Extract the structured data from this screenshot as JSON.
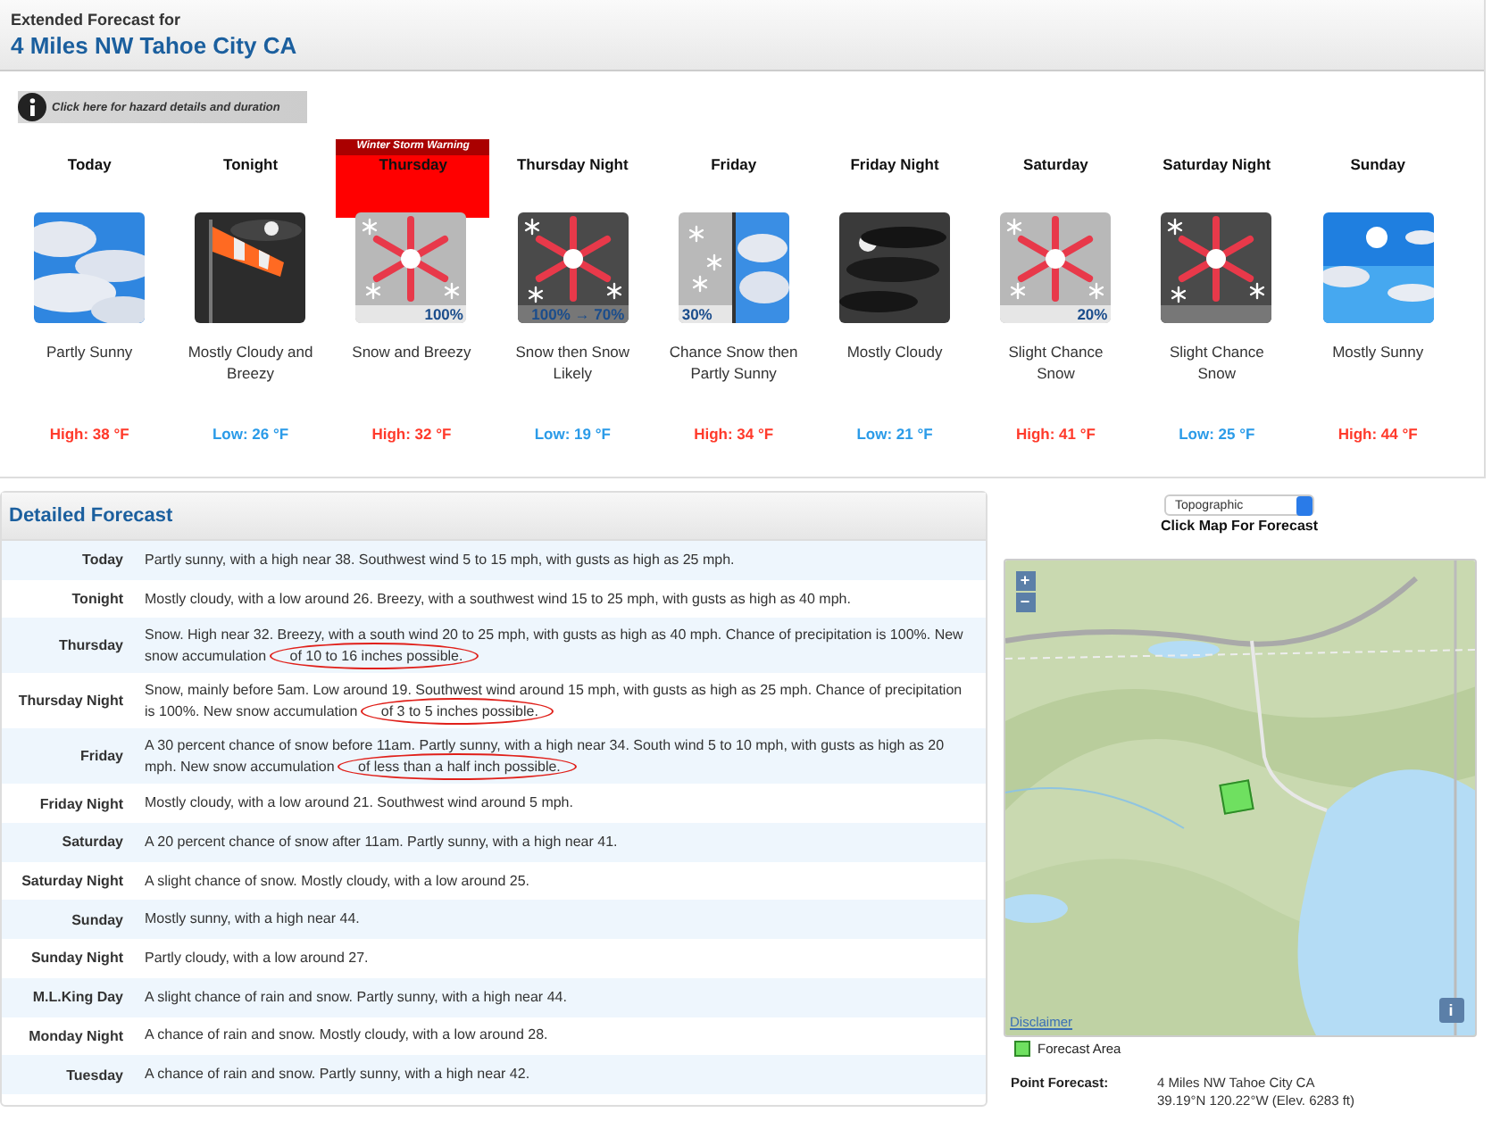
{
  "header": {
    "subtitle": "Extended Forecast for",
    "location": "4 Miles NW Tahoe City CA"
  },
  "hazard_button": {
    "label": "Click here for hazard details and duration"
  },
  "periods": [
    {
      "name": "Today",
      "kind": "partly-sunny",
      "short": "Partly Sunny",
      "temp": {
        "kind": "high",
        "text": "High: 38 °F"
      }
    },
    {
      "name": "Tonight",
      "kind": "windsock-night",
      "short": "Mostly Cloudy and Breezy",
      "temp": {
        "kind": "low",
        "text": "Low: 26 °F"
      }
    },
    {
      "name": "Thursday",
      "kind": "snow",
      "pop": "100%",
      "short": "Snow and Breezy",
      "temp": {
        "kind": "high",
        "text": "High: 32 °F"
      },
      "warning": "Winter Storm Warning"
    },
    {
      "name": "Thursday Night",
      "kind": "snow-night",
      "pop": "100% → 70%",
      "short": "Snow then Snow Likely",
      "temp": {
        "kind": "low",
        "text": "Low: 19 °F"
      }
    },
    {
      "name": "Friday",
      "kind": "chance-snow-sunny",
      "pop": "30%",
      "short": "Chance Snow then Partly Sunny",
      "temp": {
        "kind": "high",
        "text": "High: 34 °F"
      }
    },
    {
      "name": "Friday Night",
      "kind": "cloudy-night",
      "short": "Mostly Cloudy",
      "temp": {
        "kind": "low",
        "text": "Low: 21 °F"
      }
    },
    {
      "name": "Saturday",
      "kind": "snow",
      "pop": "20%",
      "short": "Slight Chance Snow",
      "temp": {
        "kind": "high",
        "text": "High: 41 °F"
      }
    },
    {
      "name": "Saturday Night",
      "kind": "snow-night",
      "short": "Slight Chance Snow",
      "temp": {
        "kind": "low",
        "text": "Low: 25 °F"
      }
    },
    {
      "name": "Sunday",
      "kind": "sunny",
      "short": "Mostly Sunny",
      "temp": {
        "kind": "high",
        "text": "High: 44 °F"
      }
    }
  ],
  "detailed": {
    "title": "Detailed Forecast",
    "rows": [
      {
        "period": "Today",
        "text": "Partly sunny, with a high near 38. Southwest wind 5 to 15 mph, with gusts as high as 25 mph."
      },
      {
        "period": "Tonight",
        "text": "Mostly cloudy, with a low around 26. Breezy, with a southwest wind 15 to 25 mph, with gusts as high as 40 mph."
      },
      {
        "period": "Thursday",
        "text": "Snow. High near 32. Breezy, with a south wind 20 to 25 mph, with gusts as high as 40 mph. Chance of precipitation is 100%. New snow accumulation",
        "circled": " of 10 to 16 inches possible."
      },
      {
        "period": "Thursday Night",
        "text": "Snow, mainly before 5am. Low around 19. Southwest wind around 15 mph, with gusts as high as 25 mph. Chance of precipitation is 100%. New snow accumulation",
        "circled": " of 3 to 5 inches possible."
      },
      {
        "period": "Friday",
        "text": "A 30 percent chance of snow before 11am. Partly sunny, with a high near 34. South wind 5 to 10 mph, with gusts as high as 20 mph. New snow accumulation",
        "circled": " of less than a half inch possible."
      },
      {
        "period": "Friday Night",
        "text": "Mostly cloudy, with a low around 21. Southwest wind around 5 mph."
      },
      {
        "period": "Saturday",
        "text": "A 20 percent chance of snow after 11am. Partly sunny, with a high near 41."
      },
      {
        "period": "Saturday Night",
        "text": "A slight chance of snow. Mostly cloudy, with a low around 25."
      },
      {
        "period": "Sunday",
        "text": "Mostly sunny, with a high near 44."
      },
      {
        "period": "Sunday Night",
        "text": "Partly cloudy, with a low around 27."
      },
      {
        "period": "M.L.King Day",
        "text": "A slight chance of rain and snow. Partly sunny, with a high near 44."
      },
      {
        "period": "Monday Night",
        "text": "A chance of rain and snow. Mostly cloudy, with a low around 28."
      },
      {
        "period": "Tuesday",
        "text": "A chance of rain and snow. Partly sunny, with a high near 42."
      }
    ]
  },
  "map": {
    "layer_select": "Topographic",
    "caption": "Click Map For Forecast",
    "zoom_in": "+",
    "zoom_out": "−",
    "disclaimer": "Disclaimer",
    "info": "i",
    "legend": "Forecast Area",
    "point_forecast": {
      "label": "Point Forecast:",
      "location": "4 Miles NW Tahoe City CA",
      "coords": "39.19°N 120.22°W (Elev. 6283 ft)"
    }
  }
}
